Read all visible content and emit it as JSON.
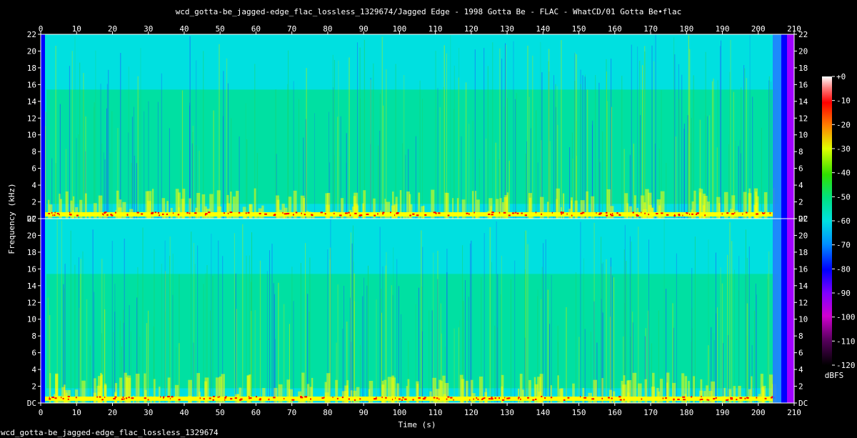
{
  "chart_data": {
    "type": "heatmap",
    "title": "wcd_gotta-be_jagged-edge_flac_lossless_1329674/Jagged Edge - 1998 Gotta Be - FLAC - WhatCD/01 Gotta Be•flac",
    "xlabel": "Time (s)",
    "ylabel": "Frequency (kHz)",
    "xlim": [
      0,
      210
    ],
    "x_ticks": [
      "0",
      "10",
      "20",
      "30",
      "40",
      "50",
      "60",
      "70",
      "80",
      "90",
      "100",
      "110",
      "120",
      "130",
      "140",
      "150",
      "160",
      "170",
      "180",
      "190",
      "200",
      "210"
    ],
    "ylim": [
      0,
      22
    ],
    "y_ticks": [
      "DC",
      "2",
      "4",
      "6",
      "8",
      "10",
      "12",
      "14",
      "16",
      "18",
      "20",
      "22"
    ],
    "channels": 2,
    "colorbar": {
      "label": "dBFS",
      "ticks": [
        "+0",
        "-10",
        "-20",
        "-30",
        "-40",
        "-50",
        "-60",
        "-70",
        "-80",
        "-90",
        "-100",
        "-110",
        "-120"
      ],
      "range": [
        -120,
        0
      ]
    },
    "colors": {
      "background": "#000000",
      "high_energy": "#ff0000",
      "mid_energy": "#ffff00",
      "typical": "#00e070",
      "low_energy": "#00e0e0",
      "floor": "#0000ff",
      "axis": "#ffffff"
    }
  },
  "footer": "wcd_gotta-be_jagged-edge_flac_lossless_1329674"
}
